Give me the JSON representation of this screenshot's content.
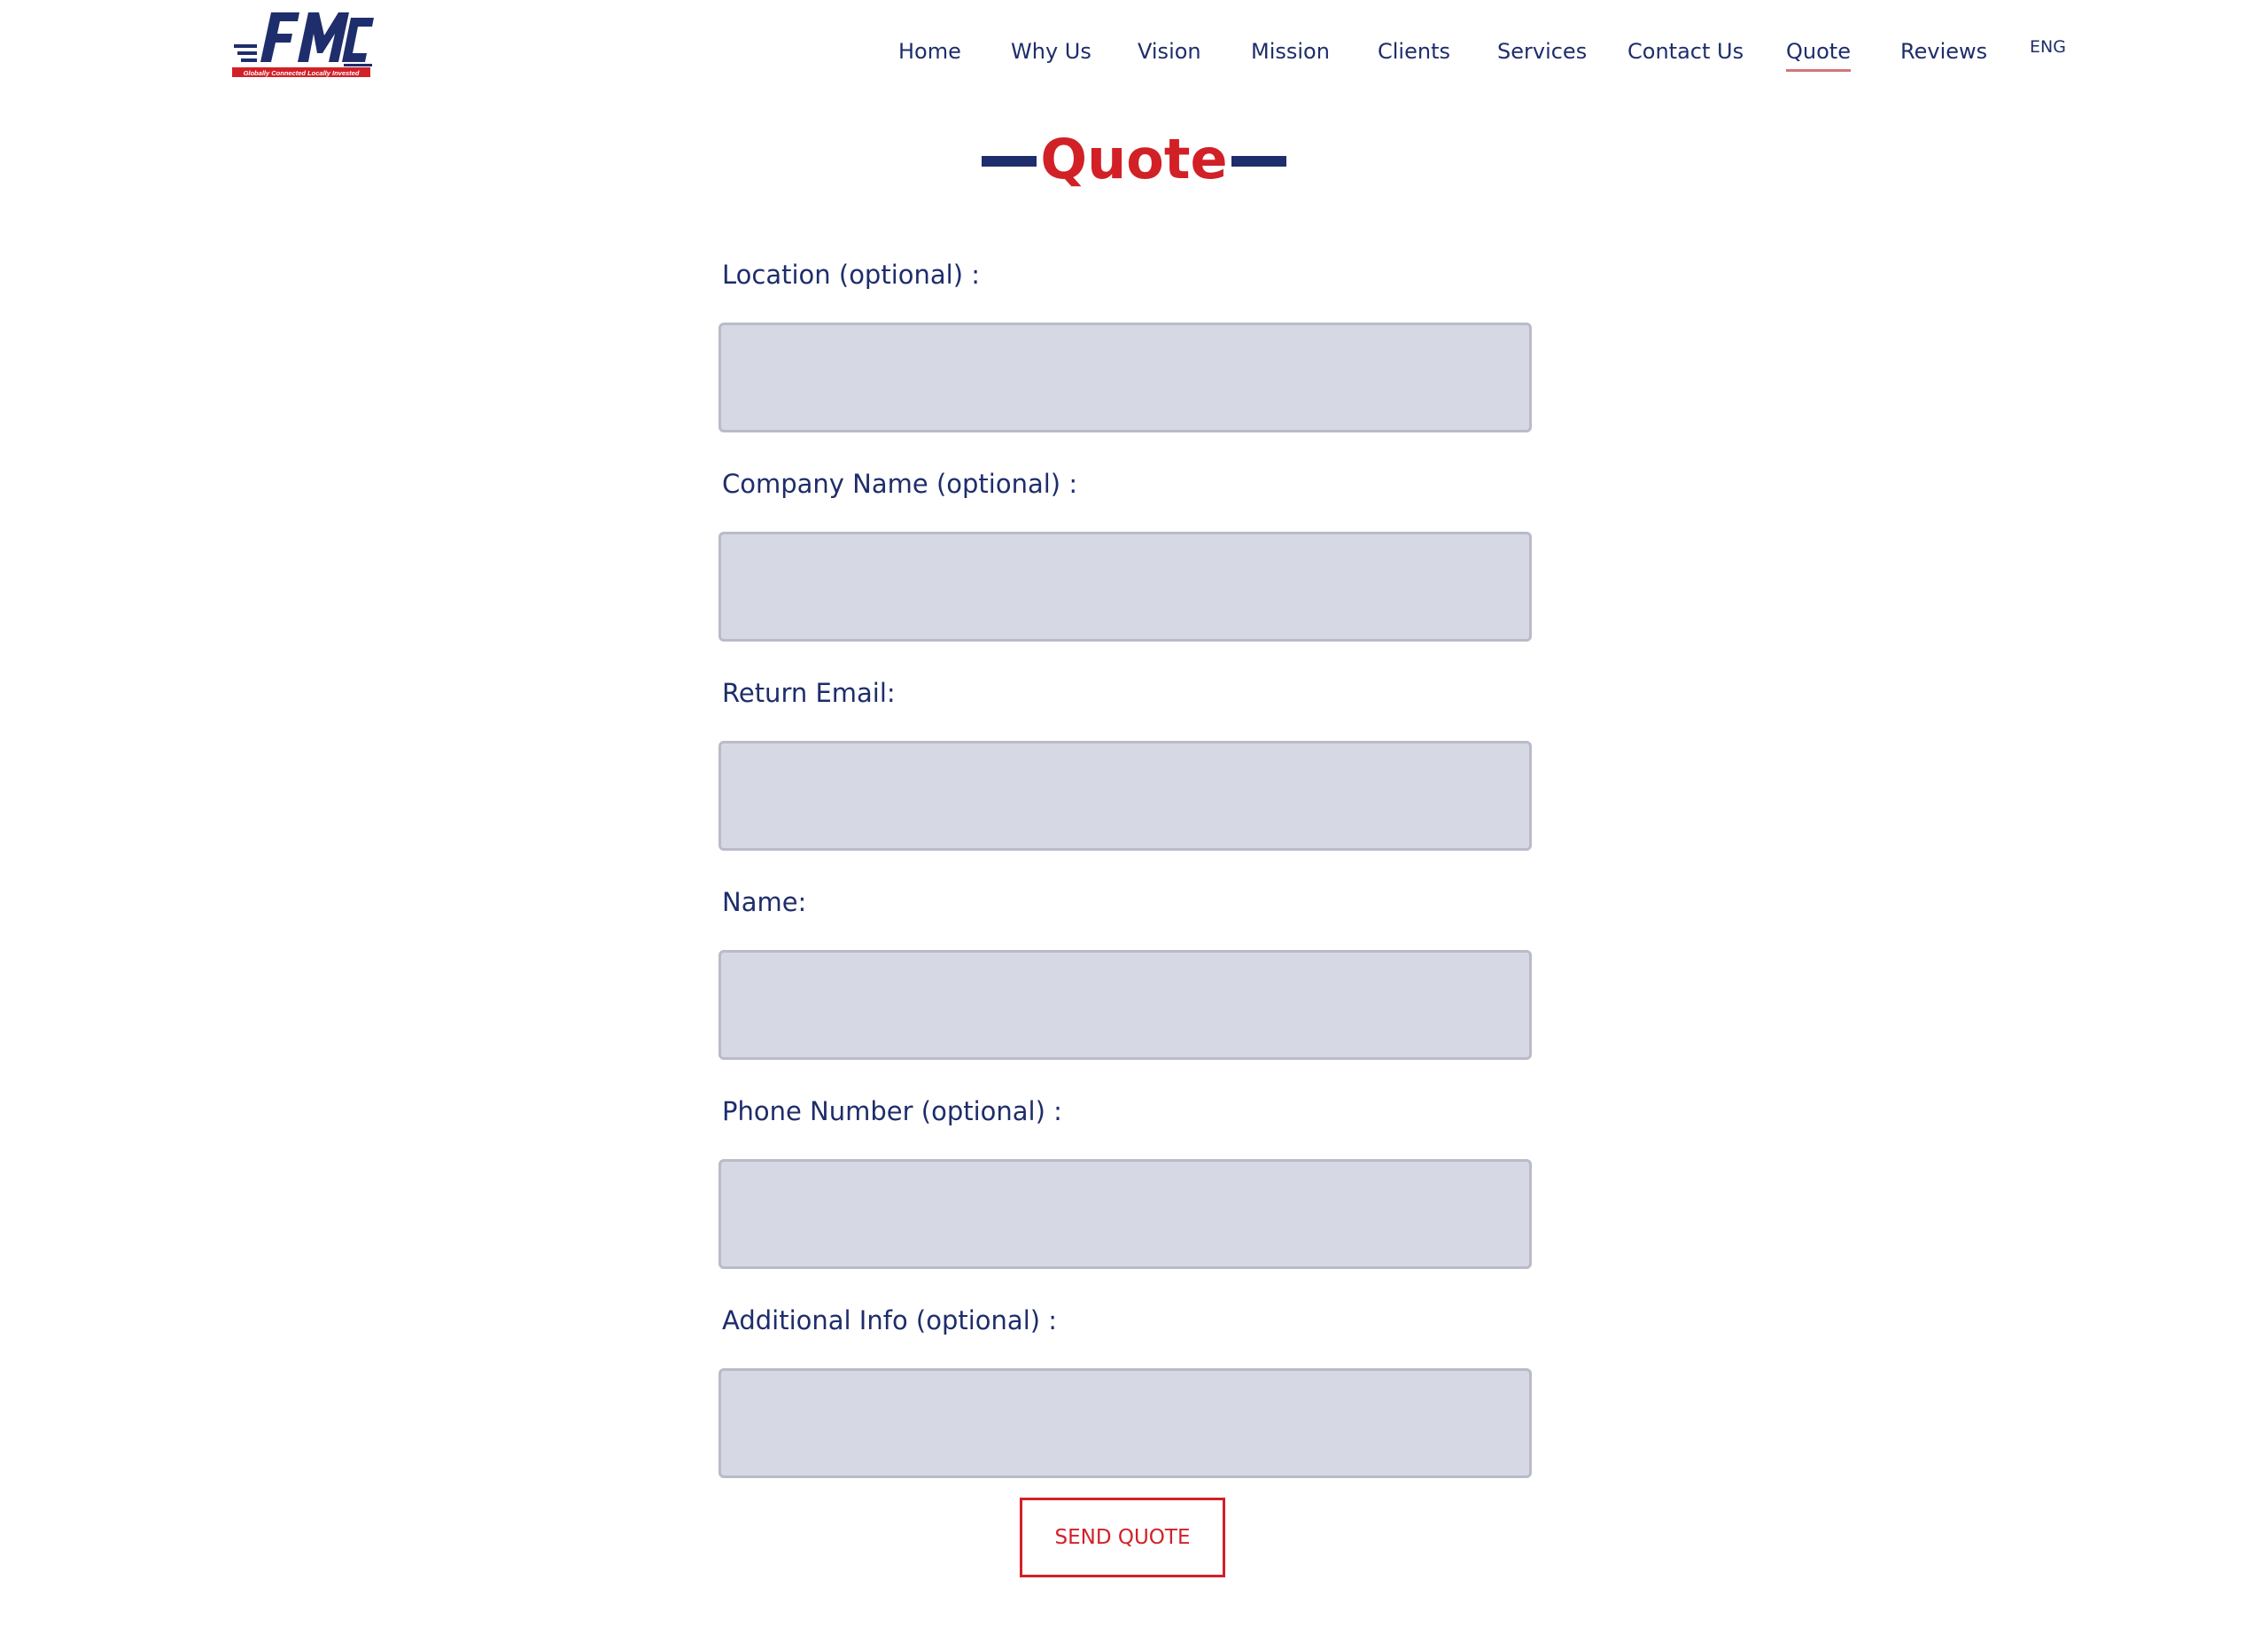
{
  "brand": {
    "logo_text": "FMC",
    "tagline": "Globally Connected Locally Invested",
    "colors": {
      "navy": "#1e2d6b",
      "red": "#d22027"
    }
  },
  "nav": {
    "items": [
      {
        "label": "Home"
      },
      {
        "label": "Why Us"
      },
      {
        "label": "Vision"
      },
      {
        "label": "Mission"
      },
      {
        "label": "Clients"
      },
      {
        "label": "Services"
      },
      {
        "label": "Contact Us"
      },
      {
        "label": "Quote",
        "active": true
      },
      {
        "label": "Reviews"
      }
    ],
    "language": "ENG"
  },
  "page": {
    "title": "Quote"
  },
  "form": {
    "fields": [
      {
        "label": "Location (optional) :",
        "value": ""
      },
      {
        "label": "Company Name (optional) :",
        "value": ""
      },
      {
        "label": "Return Email:",
        "value": ""
      },
      {
        "label": "Name:",
        "value": ""
      },
      {
        "label": "Phone Number (optional) :",
        "value": ""
      },
      {
        "label": "Additional Info (optional) :",
        "value": ""
      }
    ],
    "submit_label": "SEND QUOTE"
  }
}
